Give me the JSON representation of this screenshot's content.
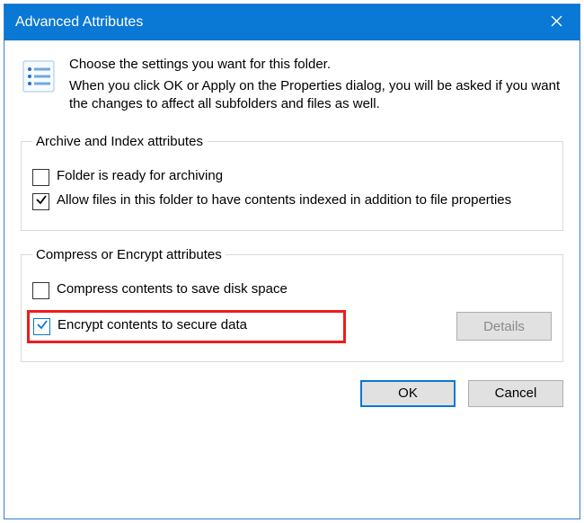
{
  "titlebar": {
    "title": "Advanced Attributes"
  },
  "intro": {
    "line1": "Choose the settings you want for this folder.",
    "line2": "When you click OK or Apply on the Properties dialog, you will be asked if you want the changes to affect all subfolders and files as well."
  },
  "group1": {
    "legend": "Archive and Index attributes",
    "archive_label": "Folder is ready for archiving",
    "index_label": "Allow files in this folder to have contents indexed in addition to file properties"
  },
  "group2": {
    "legend": "Compress or Encrypt attributes",
    "compress_label": "Compress contents to save disk space",
    "encrypt_label": "Encrypt contents to secure data",
    "details_label": "Details"
  },
  "footer": {
    "ok_label": "OK",
    "cancel_label": "Cancel"
  }
}
